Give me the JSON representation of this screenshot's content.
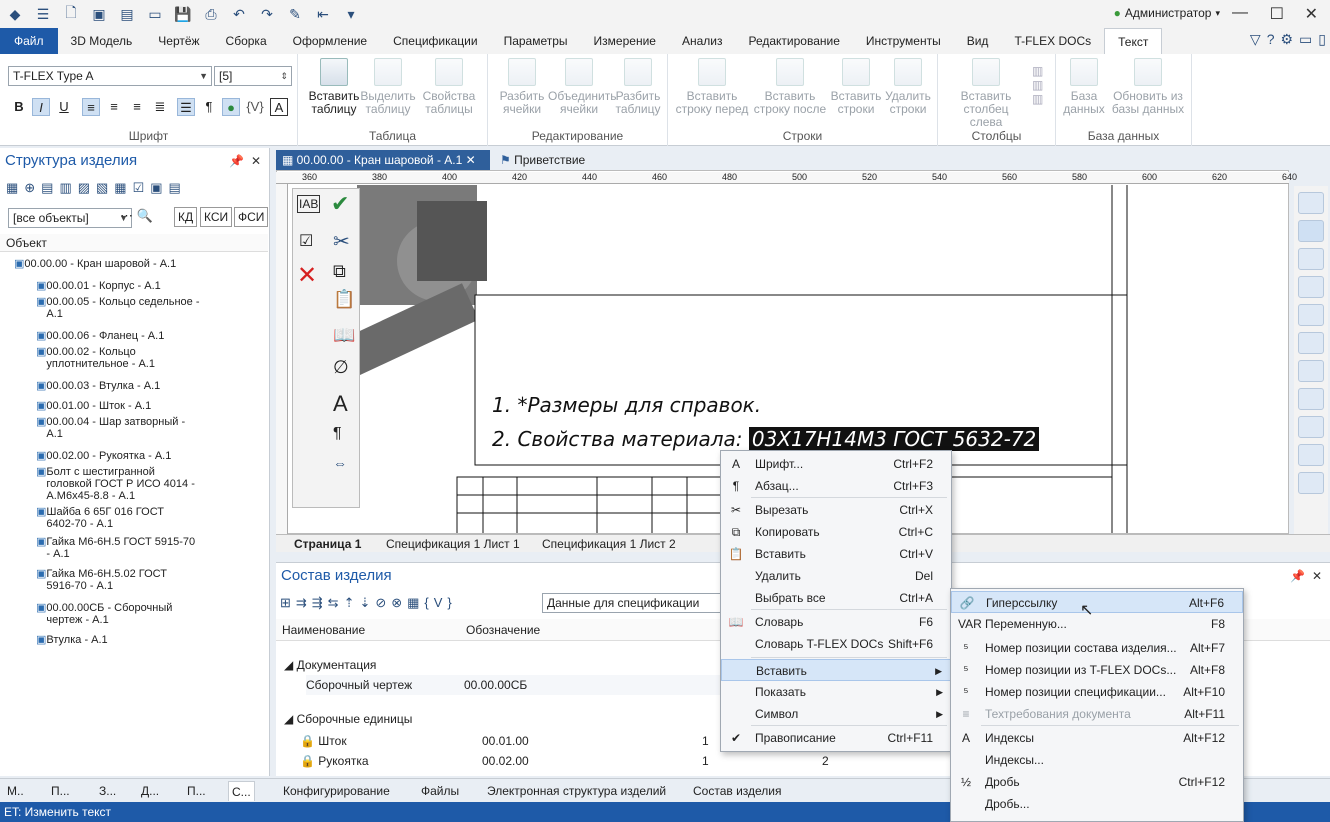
{
  "user": "Администратор",
  "tabs": [
    "Файл",
    "3D Модель",
    "Чертёж",
    "Сборка",
    "Оформление",
    "Спецификации",
    "Параметры",
    "Измерение",
    "Анализ",
    "Редактирование",
    "Инструменты",
    "Вид",
    "T-FLEX DOCs",
    "Текст"
  ],
  "font": {
    "name": "T-FLEX Type A",
    "size": "[5]",
    "group": "Шрифт"
  },
  "ribbon": {
    "table_group": "Таблица",
    "insert_table": "Вставить таблицу",
    "select_table": "Выделить таблицу",
    "table_params": "Свойства таблицы",
    "edit_group": "Редактирование",
    "split_cells": "Разбить ячейки",
    "merge_cells": "Объединить ячейки",
    "split_table": "Разбить таблицу",
    "rows_group": "Строки",
    "insert_row_before": "Вставить строку перед",
    "insert_row_after": "Вставить строку после",
    "insert_rows": "Вставить строки",
    "delete_rows": "Удалить строки",
    "cols_group": "Столбцы",
    "insert_col_left": "Вставить столбец слева",
    "db_group": "База данных",
    "db_data": "База данных",
    "refresh_db": "Обновить из базы данных"
  },
  "left": {
    "title": "Структура изделия",
    "filter": "[все объекты]",
    "btn_kd": "КД",
    "btn_ksi": "КСИ",
    "btn_fsi": "ФСИ",
    "column": "Объект",
    "items": [
      {
        "t1": "00.00.00 - Кран шаровой - А.1",
        "t2": ""
      },
      {
        "t1": "00.00.01 - Корпус - А.1",
        "t2": ""
      },
      {
        "t1": "00.00.05 - Кольцо седельное -",
        "t2": "А.1"
      },
      {
        "t1": "00.00.06 - Фланец - А.1",
        "t2": ""
      },
      {
        "t1": "00.00.02 - Кольцо",
        "t2": "уплотнительное - А.1"
      },
      {
        "t1": "00.00.03 - Втулка - А.1",
        "t2": ""
      },
      {
        "t1": "00.01.00 - Шток - А.1",
        "t2": ""
      },
      {
        "t1": "00.00.04 - Шар затворный -",
        "t2": "А.1"
      },
      {
        "t1": "00.02.00 - Рукоятка - А.1",
        "t2": ""
      },
      {
        "t1": "Болт с шестигранной",
        "t2": "головкой ГОСТ Р ИСО 4014 -",
        "t3": "А.М6х45-8.8 - А.1"
      },
      {
        "t1": "Шайба 6 65Г 016 ГОСТ",
        "t2": "6402-70 - А.1"
      },
      {
        "t1": "Гайка М6-6Н.5 ГОСТ 5915-70",
        "t2": "- А.1"
      },
      {
        "t1": "Гайка М6-6Н.5.02 ГОСТ",
        "t2": "5916-70 - А.1"
      },
      {
        "t1": "00.00.00СБ - Сборочный",
        "t2": "чертеж - А.1"
      },
      {
        "t1": "Втулка  - А.1",
        "t2": ""
      }
    ]
  },
  "doc_tabs": [
    "00.00.00 - Кран шаровой - А.1",
    "Приветствие"
  ],
  "ruler": [
    "360",
    "380",
    "400",
    "420",
    "440",
    "460",
    "480",
    "500",
    "520",
    "540",
    "560",
    "580",
    "600",
    "620",
    "640"
  ],
  "drawing": {
    "note1": "1. *Размеры для справок.",
    "note2": "2. Свойства материала: ",
    "selected": "03Х17Н14М3 ГОСТ 5632-72"
  },
  "page_tabs": [
    "Страница 1",
    "Спецификация 1 Лист 1",
    "Спецификация 1 Лист 2"
  ],
  "compo": {
    "title": "Состав изделия",
    "spec_combo": "Данные для спецификации",
    "col_name": "Наименование",
    "col_des": "Обозначение",
    "sec_doc": "Документация",
    "row_doc": "Сборочный чертеж",
    "row_doc_des": "00.00.00СБ",
    "sec_asm": "Сборочные единицы",
    "row1": "Шток",
    "row1_des": "00.01.00",
    "row1_q": "1",
    "row2": "Рукоятка",
    "row2_des": "00.02.00",
    "row2_q": "1",
    "row2_q2": "2"
  },
  "bottom_tabs": [
    "М..",
    "П...",
    "З...",
    "Д...",
    "П...",
    "С...",
    "Конфигурирование",
    "Файлы",
    "Электронная структура изделий",
    "Состав изделия"
  ],
  "status": "ET: Изменить текст",
  "menu1": [
    {
      "l": "Шрифт...",
      "s": "Ctrl+F2",
      "i": "A"
    },
    {
      "l": "Абзац...",
      "s": "Ctrl+F3",
      "i": "¶"
    },
    {
      "l": "Вырезать",
      "s": "Ctrl+X",
      "i": "✂"
    },
    {
      "l": "Копировать",
      "s": "Ctrl+C",
      "i": "⧉"
    },
    {
      "l": "Вставить",
      "s": "Ctrl+V",
      "i": "📋"
    },
    {
      "l": "Удалить",
      "s": "Del",
      "i": ""
    },
    {
      "l": "Выбрать все",
      "s": "Ctrl+A",
      "i": ""
    },
    {
      "l": "Словарь",
      "s": "F6",
      "i": "📖"
    },
    {
      "l": "Словарь T-FLEX DOCs",
      "s": "Shift+F6",
      "i": ""
    },
    {
      "l": "Вставить",
      "s": "",
      "i": ""
    },
    {
      "l": "Показать",
      "s": "",
      "i": ""
    },
    {
      "l": "Символ",
      "s": "",
      "i": ""
    },
    {
      "l": "Правописание",
      "s": "Ctrl+F11",
      "i": "✔"
    }
  ],
  "menu2": [
    {
      "l": "Гиперссылку",
      "s": "Alt+F6",
      "i": "🔗"
    },
    {
      "l": "Переменную...",
      "s": "F8",
      "i": "VAR"
    },
    {
      "l": "Номер позиции состава изделия...",
      "s": "Alt+F7",
      "i": "⁵"
    },
    {
      "l": "Номер позиции из T-FLEX DOCs...",
      "s": "Alt+F8",
      "i": "⁵"
    },
    {
      "l": "Номер позиции спецификации...",
      "s": "Alt+F10",
      "i": "⁵"
    },
    {
      "l": "Техтребования документа",
      "s": "Alt+F11",
      "i": "≡"
    },
    {
      "l": "Индексы",
      "s": "Alt+F12",
      "i": "A"
    },
    {
      "l": "Индексы...",
      "s": "",
      "i": ""
    },
    {
      "l": "Дробь",
      "s": "Ctrl+F12",
      "i": "½"
    },
    {
      "l": "Дробь...",
      "s": "",
      "i": ""
    }
  ]
}
